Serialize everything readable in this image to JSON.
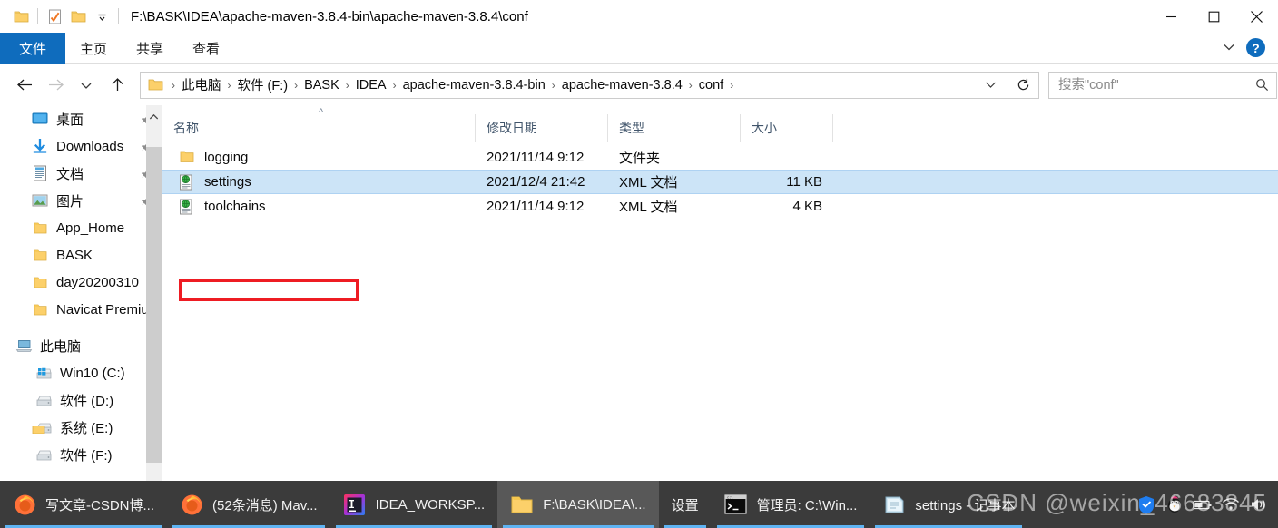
{
  "window": {
    "title_path": "F:\\BASK\\IDEA\\apache-maven-3.8.4-bin\\apache-maven-3.8.4\\conf",
    "quick_access": [
      {
        "icon": "folder-icon",
        "name": "qat-folder-icon"
      },
      {
        "icon": "properties-checkmark-icon",
        "name": "qat-properties-icon"
      },
      {
        "icon": "new-folder-icon",
        "name": "qat-new-folder-icon"
      },
      {
        "icon": "chevron-down-icon",
        "name": "qat-customize-icon"
      }
    ],
    "controls": {
      "minimize": "minimize-icon",
      "maximize": "maximize-icon",
      "close": "close-icon"
    }
  },
  "ribbon": {
    "tabs": [
      {
        "label": "文件",
        "active": true
      },
      {
        "label": "主页",
        "active": false
      },
      {
        "label": "共享",
        "active": false
      },
      {
        "label": "查看",
        "active": false
      }
    ],
    "collapse_icon": "chevron-down-icon",
    "help_label": "?"
  },
  "addressbar": {
    "back_icon": "arrow-left-icon",
    "forward_icon": "arrow-right-icon",
    "recent_icon": "chevron-down-icon",
    "up_icon": "arrow-up-icon",
    "folder_icon": "folder-icon",
    "breadcrumbs": [
      "此电脑",
      "软件 (F:)",
      "BASK",
      "IDEA",
      "apache-maven-3.8.4-bin",
      "apache-maven-3.8.4",
      "conf"
    ],
    "dropdown_icon": "chevron-down-icon",
    "refresh_icon": "refresh-icon",
    "search_placeholder": "搜索\"conf\"",
    "search_value": "",
    "search_icon": "search-icon"
  },
  "navpane": {
    "items": [
      {
        "label": "桌面",
        "icon": "desktop-icon",
        "pinned": true,
        "indent": "child"
      },
      {
        "label": "Downloads",
        "icon": "downloads-icon",
        "pinned": true,
        "indent": "child"
      },
      {
        "label": "文档",
        "icon": "documents-icon",
        "pinned": true,
        "indent": "child"
      },
      {
        "label": "图片",
        "icon": "pictures-icon",
        "pinned": true,
        "indent": "child"
      },
      {
        "label": "App_Home",
        "icon": "folder-icon",
        "pinned": false,
        "indent": "child"
      },
      {
        "label": "BASK",
        "icon": "folder-icon",
        "pinned": false,
        "indent": "child"
      },
      {
        "label": "day20200310",
        "icon": "folder-icon",
        "pinned": false,
        "indent": "child"
      },
      {
        "label": "Navicat Premiu",
        "icon": "folder-icon",
        "pinned": false,
        "indent": "child"
      },
      {
        "label": "",
        "icon": "spacer",
        "pinned": false,
        "indent": "gap"
      },
      {
        "label": "此电脑",
        "icon": "this-pc-icon",
        "pinned": false,
        "indent": "root"
      },
      {
        "label": "Win10 (C:)",
        "icon": "windows-drive-icon",
        "pinned": false,
        "indent": "child"
      },
      {
        "label": "软件 (D:)",
        "icon": "drive-icon",
        "pinned": false,
        "indent": "child"
      },
      {
        "label": "系统 (E:)",
        "icon": "drive-icon",
        "pinned": false,
        "indent": "child"
      },
      {
        "label": "软件 (F:)",
        "icon": "drive-icon",
        "pinned": false,
        "indent": "child"
      }
    ],
    "scroll_up_icon": "chevron-up-icon"
  },
  "filelist": {
    "columns": [
      {
        "key": "name",
        "label": "名称",
        "sorted": "asc"
      },
      {
        "key": "date",
        "label": "修改日期",
        "sorted": ""
      },
      {
        "key": "type",
        "label": "类型",
        "sorted": ""
      },
      {
        "key": "size",
        "label": "大小",
        "sorted": ""
      }
    ],
    "sort_caret": "^",
    "rows": [
      {
        "name": "logging",
        "date": "2021/11/14 9:12",
        "type": "文件夹",
        "size": "",
        "icon": "folder-icon",
        "selected": false
      },
      {
        "name": "settings",
        "date": "2021/12/4 21:42",
        "type": "XML 文档",
        "size": "11 KB",
        "icon": "xml-file-icon",
        "selected": true
      },
      {
        "name": "toolchains",
        "date": "2021/11/14 9:12",
        "type": "XML 文档",
        "size": "4 KB",
        "icon": "xml-file-icon",
        "selected": false
      }
    ],
    "annotation": {
      "color": "#ee1c23",
      "target": "settings"
    }
  },
  "taskbar": {
    "items": [
      {
        "label": "写文章-CSDN博...",
        "icon": "firefox-icon",
        "active": false
      },
      {
        "label": "(52条消息) Mav...",
        "icon": "firefox-icon",
        "active": false
      },
      {
        "label": "IDEA_WORKSP...",
        "icon": "intellij-idea-icon",
        "active": false
      },
      {
        "label": "F:\\BASK\\IDEA\\...",
        "icon": "folder-icon",
        "active": true
      },
      {
        "label": "设置",
        "icon": "settings-icon",
        "active": false
      },
      {
        "label": "管理员: C:\\Win...",
        "icon": "command-prompt-icon",
        "active": false
      },
      {
        "label": "settings - 记事本",
        "icon": "notepad-icon",
        "active": false
      }
    ],
    "tray": [
      {
        "name": "tencent-manager-icon"
      },
      {
        "name": "qq-icon"
      },
      {
        "name": "battery-icon"
      },
      {
        "name": "network-icon"
      },
      {
        "name": "volume-icon"
      }
    ]
  },
  "watermark": {
    "text": "CSDN @weixin_46683845"
  }
}
